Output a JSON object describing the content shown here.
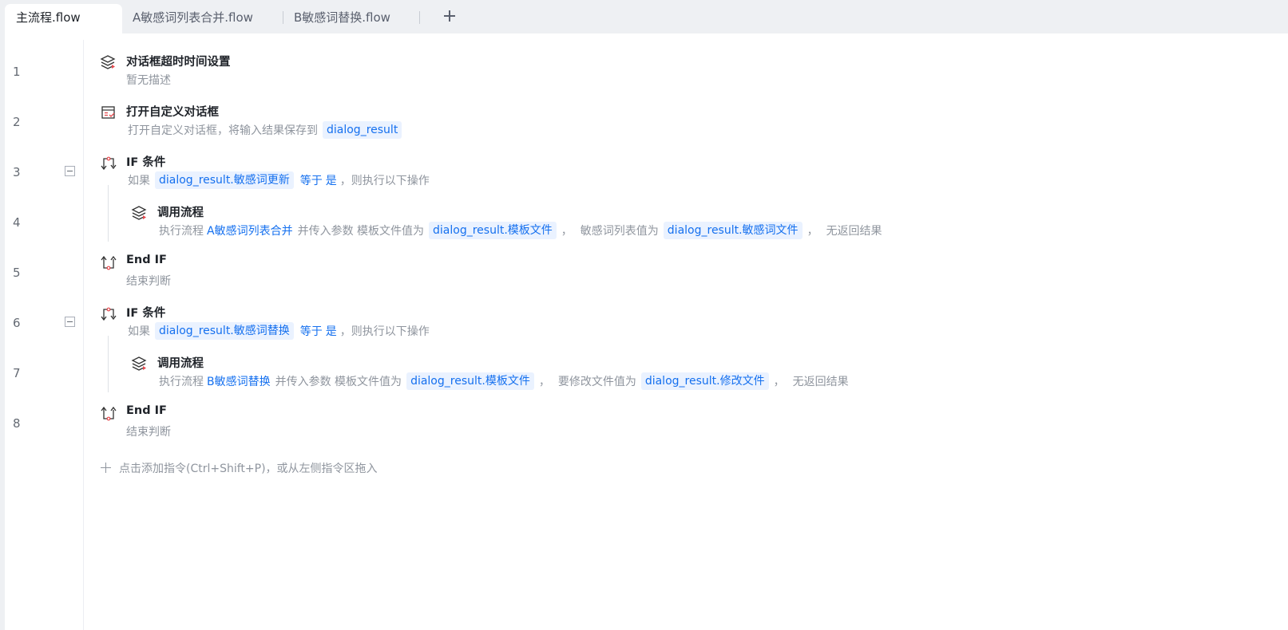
{
  "tabs": [
    {
      "label": "主流程.flow",
      "active": true
    },
    {
      "label": "A敏感词列表合并.flow",
      "active": false
    },
    {
      "label": "B敏感词替换.flow",
      "active": false
    }
  ],
  "rows": [
    {
      "no": "1",
      "title": "对话框超时时间设置",
      "desc": "暂无描述",
      "icon": "layers-icon"
    },
    {
      "no": "2",
      "title": "打开自定义对话框",
      "desc_prefix": "打开自定义对话框，将输入结果保存到",
      "var": "dialog_result",
      "icon": "dialog-form-icon"
    },
    {
      "no": "3",
      "title": "IF 条件",
      "icon": "if-branch-icon",
      "desc": {
        "prefix": "如果",
        "var": "dialog_result.敏感词更新",
        "op": "等于",
        "val": "是",
        "suffix": "，则执行以下操作"
      }
    },
    {
      "no": "4",
      "title": "调用流程",
      "icon": "layers-icon",
      "desc": {
        "prefix": "执行流程",
        "flow": "A敏感词列表合并",
        "mid": "并传入参数 模板文件值为",
        "var1": "dialog_result.模板文件",
        "sep1": "，",
        "param2": "敏感词列表值为",
        "var2": "dialog_result.敏感词文件",
        "sep2": "，",
        "suffix": "无返回结果"
      }
    },
    {
      "no": "5",
      "title": "End IF",
      "desc": "结束判断",
      "icon": "end-if-icon"
    },
    {
      "no": "6",
      "title": "IF 条件",
      "icon": "if-branch-icon",
      "desc": {
        "prefix": "如果",
        "var": "dialog_result.敏感词替换",
        "op": "等于",
        "val": "是",
        "suffix": "，则执行以下操作"
      }
    },
    {
      "no": "7",
      "title": "调用流程",
      "icon": "layers-icon",
      "desc": {
        "prefix": "执行流程",
        "flow": "B敏感词替换",
        "mid": "并传入参数 模板文件值为",
        "var1": "dialog_result.模板文件",
        "sep1": "，",
        "param2": "要修改文件值为",
        "var2": "dialog_result.修改文件",
        "sep2": "，",
        "suffix": "无返回结果"
      }
    },
    {
      "no": "8",
      "title": "End IF",
      "desc": "结束判断",
      "icon": "end-if-icon"
    }
  ],
  "hint": "点击添加指令(Ctrl+Shift+P)，或从左侧指令区拖入",
  "colors": {
    "accent": "#1570ef",
    "var_bg": "#eaf2ff",
    "muted": "#8f959e",
    "icon_red": "#e5484d"
  }
}
